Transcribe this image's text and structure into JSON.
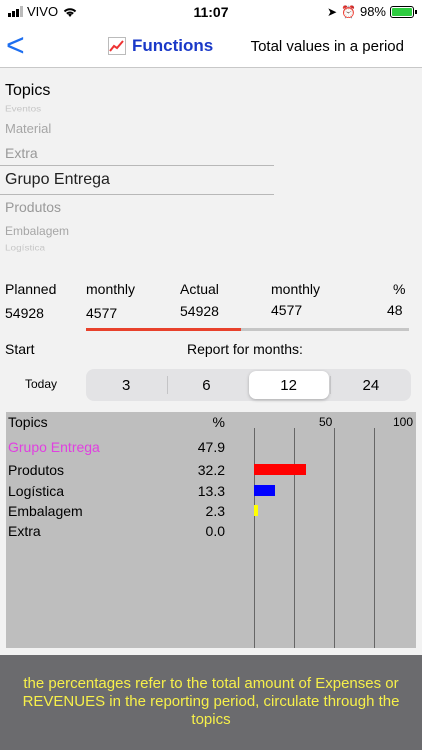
{
  "status_bar": {
    "carrier": "VIVO",
    "time": "11:07",
    "battery": "98%"
  },
  "nav": {
    "back": "<",
    "title": "Functions",
    "right": "Total values in a period",
    "title_icon": "chart-increasing-icon"
  },
  "topics": [
    {
      "label": "Topics",
      "style": "header"
    },
    {
      "label": "Eventos",
      "style": "faint-small"
    },
    {
      "label": "Material",
      "style": "faint"
    },
    {
      "label": "Extra",
      "style": "medium"
    },
    {
      "label": "Grupo Entrega",
      "style": "selected"
    },
    {
      "label": "Produtos",
      "style": "medium"
    },
    {
      "label": "Embalagem",
      "style": "faint"
    },
    {
      "label": "Logística",
      "style": "faint-small"
    }
  ],
  "summary": {
    "planned_label": "Planned",
    "planned_value": "54928",
    "monthly1_label": "monthly",
    "monthly1_value": "4577",
    "actual_label": "Actual",
    "actual_value": "54928",
    "monthly2_label": "monthly",
    "monthly2_value": "4577",
    "pct_label": "%",
    "pct_value": "48",
    "progress_pct": 48,
    "progress_color": "#e8412b"
  },
  "report": {
    "start_label": "Start",
    "title": "Report for months:",
    "today_label": "Today",
    "options": [
      "3",
      "6",
      "12",
      "24"
    ],
    "selected_index": 2
  },
  "table": {
    "col_topics": "Topics",
    "col_pct": "%",
    "scale_50": "50",
    "scale_100": "100",
    "group": {
      "name": "Grupo Entrega",
      "pct": "47.9",
      "color": "#e040e0"
    },
    "rows": [
      {
        "name": "Produtos",
        "pct": "32.2",
        "value": 32.2,
        "color": "#ff0000"
      },
      {
        "name": "Logística",
        "pct": "13.3",
        "value": 13.3,
        "color": "#0000ff"
      },
      {
        "name": "Embalagem",
        "pct": "2.3",
        "value": 2.3,
        "color": "#ffff00"
      },
      {
        "name": "Extra",
        "pct": "0.0",
        "value": 0.0,
        "color": "#000000"
      }
    ]
  },
  "footer": {
    "text": "the percentages refer to the total amount of Expenses or REVENUES in the reporting period, circulate through the topics"
  }
}
